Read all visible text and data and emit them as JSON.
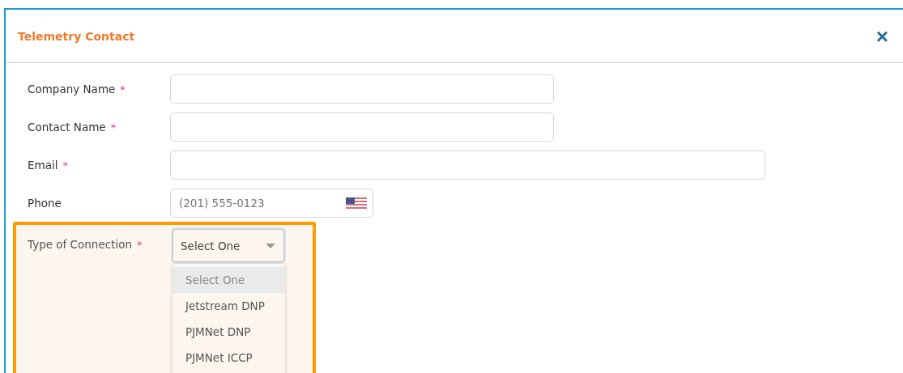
{
  "dialog": {
    "title": "Telemetry Contact",
    "close": "×"
  },
  "fields": [
    {
      "kind": "text",
      "label": "Company Name",
      "required_mark": "*"
    },
    {
      "kind": "text",
      "label": "Contact Name",
      "required_mark": "*"
    },
    {
      "kind": "text",
      "label": "Email",
      "required_mark": "*"
    },
    {
      "kind": "phone",
      "label": "Phone",
      "placeholder": "(201) 555-0123"
    },
    {
      "kind": "select",
      "label": "Type of Connection",
      "required_mark": "*",
      "highlighted": true,
      "value": "Select One",
      "expanded": true,
      "options": [
        {
          "label": "Select One",
          "selected": true
        },
        {
          "label": "Jetstream DNP",
          "selected": false
        },
        {
          "label": "PJMNet DNP",
          "selected": false
        },
        {
          "label": "PJMNet ICCP",
          "selected": false
        }
      ]
    }
  ]
}
